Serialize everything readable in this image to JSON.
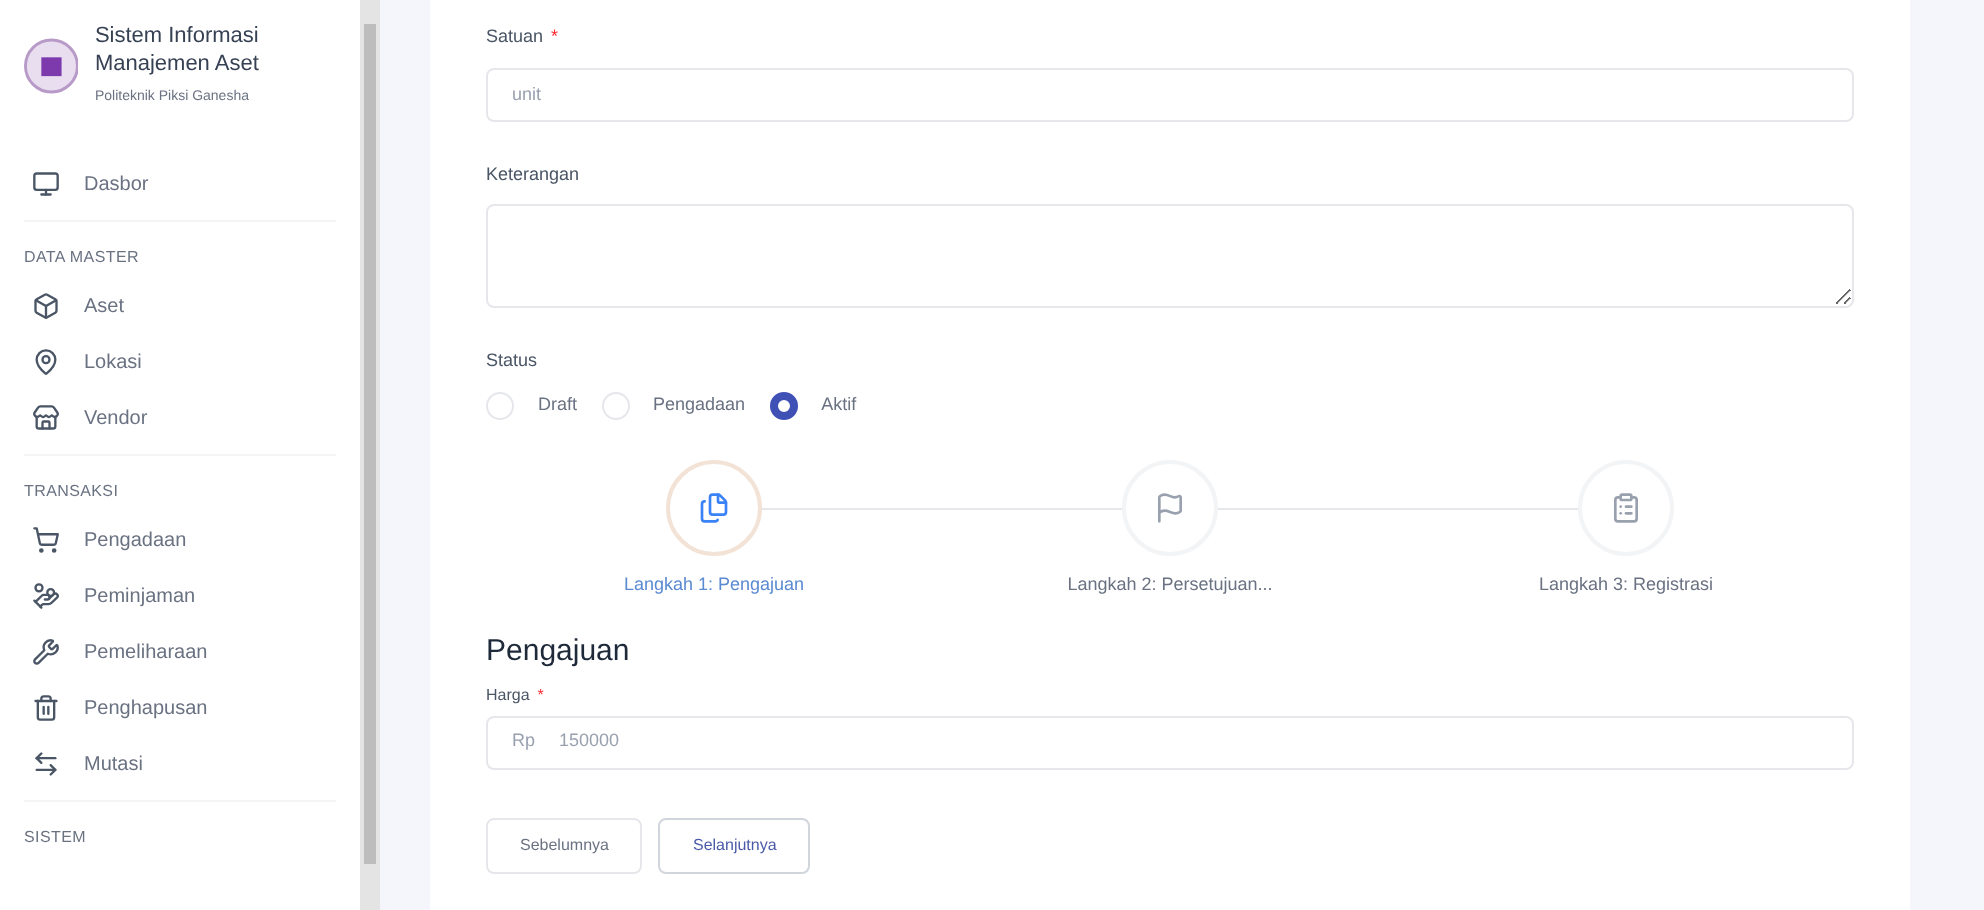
{
  "brand": {
    "title": "Sistem Informasi Manajemen Aset",
    "subtitle": "Politeknik Piksi Ganesha"
  },
  "sidebar": {
    "sections": [
      {
        "items": [
          {
            "label": "Dasbor"
          }
        ]
      },
      {
        "heading": "DATA MASTER",
        "items": [
          {
            "label": "Aset"
          },
          {
            "label": "Lokasi"
          },
          {
            "label": "Vendor"
          }
        ]
      },
      {
        "heading": "TRANSAKSI",
        "items": [
          {
            "label": "Pengadaan"
          },
          {
            "label": "Peminjaman"
          },
          {
            "label": "Pemeliharaan"
          },
          {
            "label": "Penghapusan"
          },
          {
            "label": "Mutasi"
          }
        ]
      },
      {
        "heading": "SISTEM"
      }
    ]
  },
  "form": {
    "satuan": {
      "label": "Satuan",
      "required_mark": "*",
      "placeholder": "unit"
    },
    "keterangan": {
      "label": "Keterangan"
    },
    "status": {
      "label": "Status",
      "options": [
        {
          "label": "Draft",
          "selected": false
        },
        {
          "label": "Pengadaan",
          "selected": false
        },
        {
          "label": "Aktif",
          "selected": true
        }
      ]
    }
  },
  "steps": [
    {
      "label": "Langkah 1: Pengajuan",
      "selected": true
    },
    {
      "label": "Langkah 2: Persetujuan...",
      "selected": false
    },
    {
      "label": "Langkah 3: Registrasi",
      "selected": false
    }
  ],
  "section": {
    "title": "Pengajuan",
    "harga": {
      "label": "Harga",
      "required_mark": "*",
      "prefix": "Rp",
      "value": "150000"
    }
  },
  "buttons": [
    {
      "label": "Sebelumnya",
      "disabled": true
    },
    {
      "label": "Selanjutnya",
      "disabled": false
    }
  ]
}
